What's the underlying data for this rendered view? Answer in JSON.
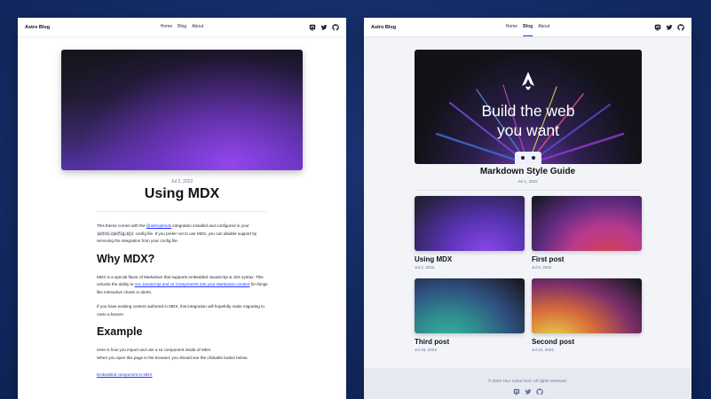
{
  "brand_title": "Astro Blog",
  "nav": [
    "Home",
    "Blog",
    "About"
  ],
  "social_icons": [
    "mastodon-icon",
    "twitter-icon",
    "github-icon"
  ],
  "colors": {
    "accent": "#2337ff",
    "background": "#16306e",
    "text": "#0f1219",
    "muted": "#60739f"
  },
  "left": {
    "active_nav": "",
    "post": {
      "date": "Jul 2, 2022",
      "title": "Using MDX",
      "intro_1": "This theme comes with the ",
      "intro_link": "@astrojs/mdx",
      "intro_2": " integration installed and configured in your ",
      "intro_code": "astro.config.mjs",
      "intro_3": " config file. If you prefer not to use MDX, you can disable support by removing the integration from your config file.",
      "h2_why": "Why MDX?",
      "why_1": "MDX is a special flavor of Markdown that supports embedded JavaScript & JSX syntax. This unlocks the ability to ",
      "why_link": "mix JavaScript and UI Components into your Markdown content",
      "why_2": " for things like interactive charts or alerts.",
      "existing": "If you have existing content authored in MDX, this integration will hopefully make migrating to Astro a breeze.",
      "h2_example": "Example",
      "example_1": "Here is how you import and use a UI component inside of MDX.",
      "example_2": "When you open this page in the browser, you should see the clickable button below.",
      "embed_link": "Embedded component in MDX"
    }
  },
  "right": {
    "active_nav": "Blog",
    "featured": {
      "image_text_1": "Build the web",
      "image_text_2": "you want",
      "title": "Markdown Style Guide",
      "date": "Jul 1, 2022"
    },
    "cards": [
      {
        "title": "Using MDX",
        "date": "Jul 2, 2022"
      },
      {
        "title": "First post",
        "date": "Jul 8, 2022"
      },
      {
        "title": "Third post",
        "date": "Jul 15, 2022"
      },
      {
        "title": "Second post",
        "date": "Jul 22, 2022"
      }
    ],
    "footer": "© 2022 Your name here. All rights reserved."
  }
}
